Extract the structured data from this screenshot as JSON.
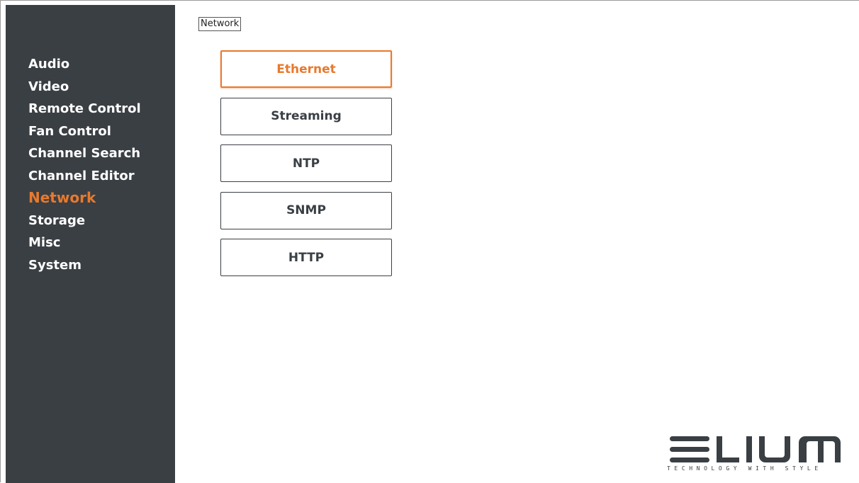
{
  "sidebar": {
    "items": [
      {
        "label": "Audio"
      },
      {
        "label": "Video"
      },
      {
        "label": "Remote Control"
      },
      {
        "label": "Fan Control"
      },
      {
        "label": "Channel Search"
      },
      {
        "label": "Channel Editor"
      },
      {
        "label": "Network",
        "active": true
      },
      {
        "label": "Storage"
      },
      {
        "label": "Misc"
      },
      {
        "label": "System"
      }
    ]
  },
  "breadcrumb": "Network",
  "subnav": {
    "items": [
      {
        "label": "Ethernet",
        "active": true
      },
      {
        "label": "Streaming"
      },
      {
        "label": "NTP"
      },
      {
        "label": "SNMP"
      },
      {
        "label": "HTTP"
      }
    ]
  },
  "logo": {
    "wordmark": "ELIUM",
    "tagline": "TECHNOLOGY WITH STYLE"
  },
  "colors": {
    "sidebar_bg": "#3a3f44",
    "accent": "#e8792d",
    "text_light": "#ffffff",
    "text_dark": "#3a3f44"
  }
}
